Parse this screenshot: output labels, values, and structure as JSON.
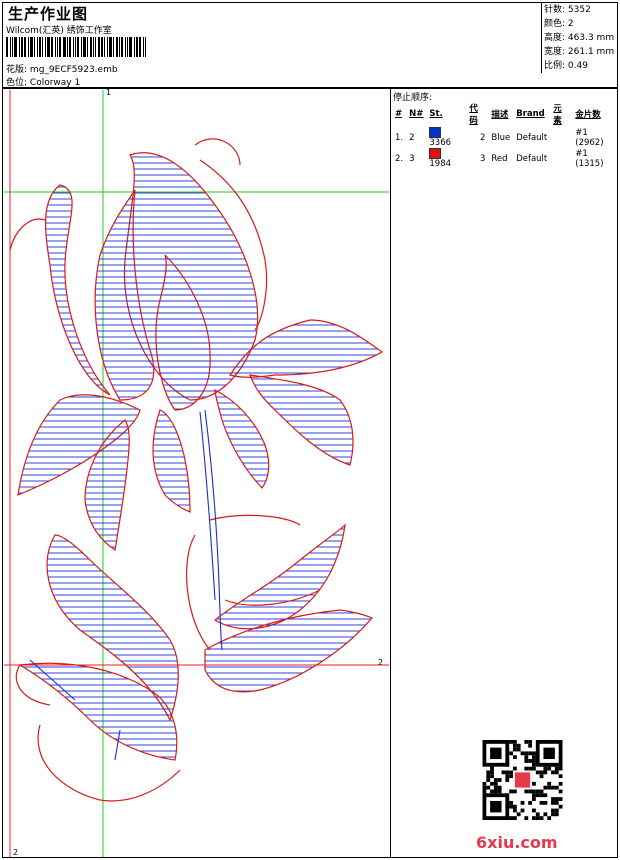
{
  "header": {
    "title": "生产作业图",
    "subtitle": "Wilcom(汇英) 绣饰工作室",
    "design_label": "花版:",
    "design_value": "mg_9ECF5923.emb",
    "colorway_label": "色位:",
    "colorway_value": "Colorway 1"
  },
  "stats": [
    {
      "label": "针数:",
      "value": "5352"
    },
    {
      "label": "颜色:",
      "value": "2"
    },
    {
      "label": "高度:",
      "value": "463.3 mm"
    },
    {
      "label": "宽度:",
      "value": "261.1 mm"
    },
    {
      "label": "比例:",
      "value": "0.49"
    }
  ],
  "stop_sequence": {
    "title": "停止顺序:",
    "columns": [
      "#",
      "N#",
      "St.",
      "代码",
      "描述",
      "Brand",
      "元素",
      "金片数"
    ],
    "rows": [
      {
        "num": "1.",
        "n": "2",
        "color": "#0033cc",
        "st": "3366",
        "code": "2",
        "desc": "Blue",
        "brand": "Default",
        "elem": "#1 (2962)"
      },
      {
        "num": "2.",
        "n": "3",
        "color": "#dd1111",
        "st": "1984",
        "code": "3",
        "desc": "Red",
        "brand": "Default",
        "elem": "#1 (1315)"
      }
    ]
  },
  "axis_labels": {
    "top": "1",
    "right": "2",
    "bottom": "2"
  },
  "watermark": "6xiu.com"
}
